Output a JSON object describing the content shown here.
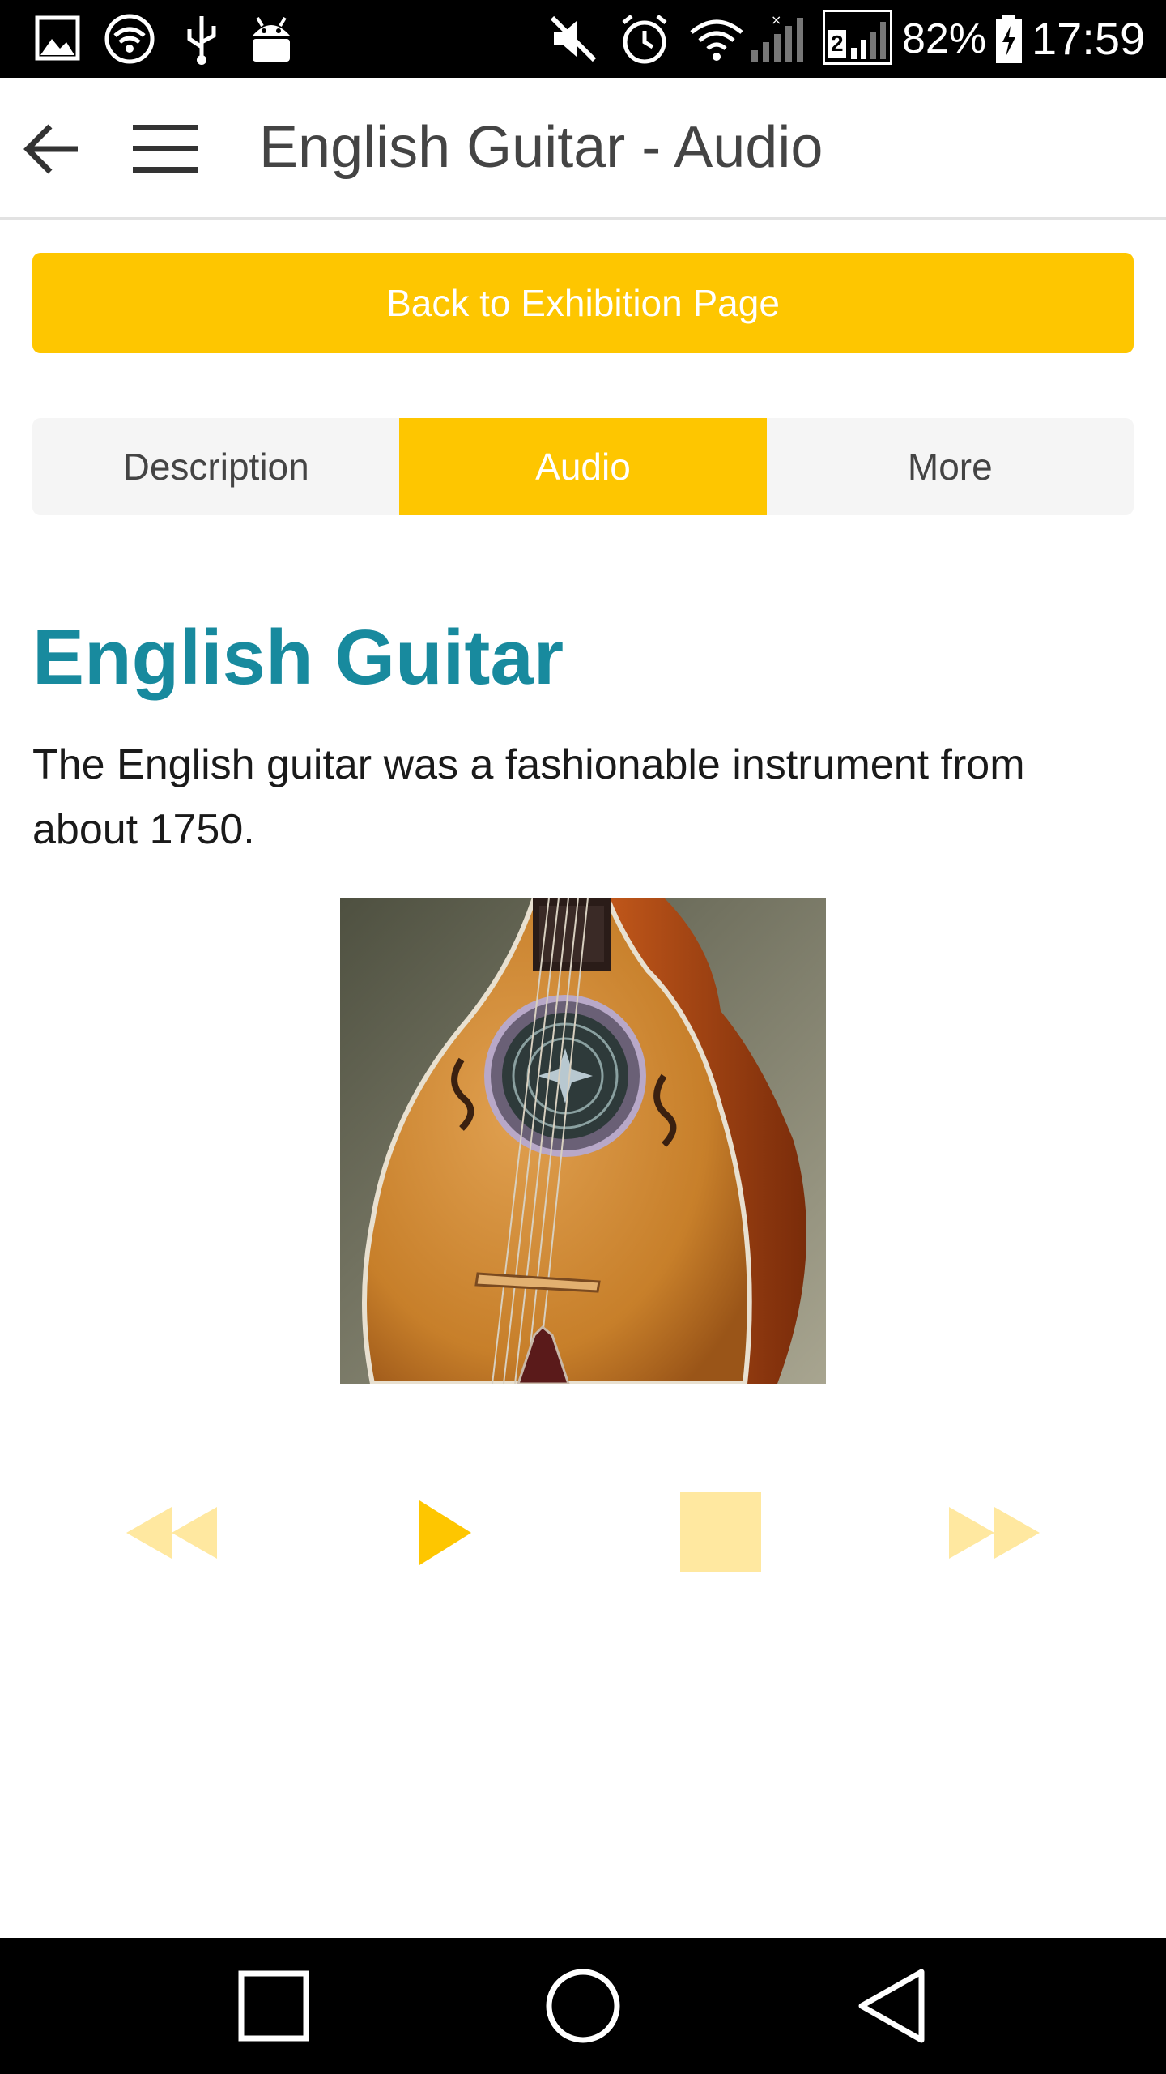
{
  "status_bar": {
    "battery_percent": "82%",
    "time": "17:59",
    "sim_label": "2",
    "icons": [
      "image-icon",
      "wifi-hotspot-icon",
      "usb-icon",
      "android-debug-icon",
      "mute-icon",
      "alarm-icon",
      "wifi-icon",
      "signal-icon",
      "battery-icon"
    ]
  },
  "app_bar": {
    "title": "English Guitar - Audio",
    "icons": [
      "back-arrow-icon",
      "menu-icon"
    ]
  },
  "back_button": {
    "label": "Back to Exhibition Page"
  },
  "tabs": [
    {
      "label": "Description",
      "active": false
    },
    {
      "label": "Audio",
      "active": true
    },
    {
      "label": "More",
      "active": false
    }
  ],
  "content": {
    "title": "English Guitar",
    "description": "The English guitar was a fashionable instrument from about 1750."
  },
  "audio_controls": {
    "icons": [
      "rewind-icon",
      "play-icon",
      "stop-icon",
      "fast-forward-icon"
    ]
  },
  "nav_bar": {
    "icons": [
      "recents-icon",
      "home-icon",
      "back-icon"
    ]
  },
  "colors": {
    "accent": "#fec600",
    "title": "#188a9e",
    "disabled_control": "#ffe8a0"
  }
}
